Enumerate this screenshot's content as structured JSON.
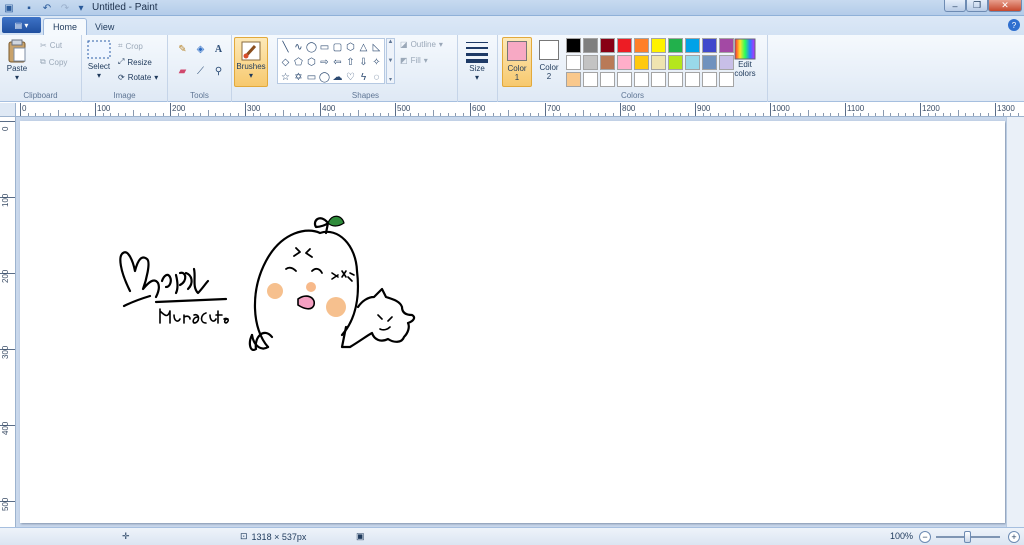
{
  "window": {
    "title": "Untitled - Paint"
  },
  "tabs": [
    {
      "label": "Home"
    },
    {
      "label": "View"
    }
  ],
  "ribbon": {
    "clipboard": {
      "label": "Clipboard",
      "paste": "Paste",
      "cut": "Cut",
      "copy": "Copy"
    },
    "image": {
      "label": "Image",
      "select": "Select",
      "crop": "Crop",
      "resize": "Resize",
      "rotate": "Rotate"
    },
    "tools": {
      "label": "Tools"
    },
    "brushes": {
      "label": "Brushes"
    },
    "shapes": {
      "label": "Shapes",
      "outline": "Outline",
      "fill": "Fill"
    },
    "size": {
      "label": "Size"
    },
    "colors": {
      "label": "Colors",
      "color1": {
        "label": "Color",
        "num": "1",
        "value": "#f7a9c4"
      },
      "color2": {
        "label": "Color",
        "num": "2",
        "value": "#ffffff"
      },
      "edit": {
        "line1": "Edit",
        "line2": "colors"
      },
      "palette": [
        "#000000",
        "#7f7f7f",
        "#880015",
        "#ed1c24",
        "#ff7f27",
        "#fff200",
        "#22b14c",
        "#00a2e8",
        "#3f48cc",
        "#a349a4",
        "#ffffff",
        "#c3c3c3",
        "#b97a57",
        "#ffaec9",
        "#ffc90e",
        "#efe4b0",
        "#b5e61d",
        "#99d9ea",
        "#7092be",
        "#c8bfe7",
        "#f9c88c",
        "#ffffff",
        "#ffffff",
        "#ffffff",
        "#ffffff",
        "#ffffff",
        "#ffffff",
        "#ffffff",
        "#ffffff",
        "#ffffff"
      ]
    }
  },
  "rulers": {
    "h": [
      "0",
      "100",
      "200",
      "300",
      "400",
      "500",
      "600",
      "700",
      "800",
      "900",
      "1000",
      "1100",
      "1200",
      "1300"
    ],
    "v": [
      "0",
      "100",
      "200",
      "300",
      "400",
      "500"
    ]
  },
  "status": {
    "dimensions": "1318 × 537px",
    "zoom": "100%"
  },
  "colors": {
    "accent_selected": "#f7c96e",
    "canvas_bg": "#c9d8ec"
  }
}
